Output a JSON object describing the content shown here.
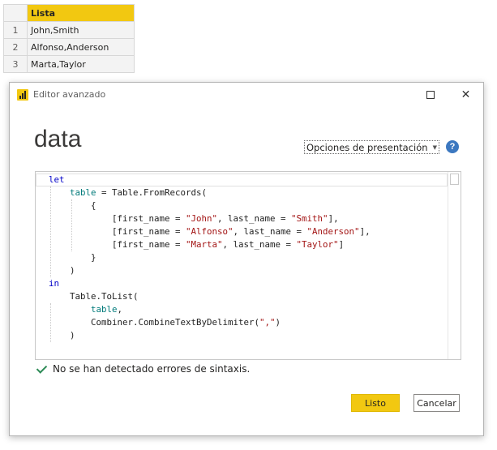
{
  "preview_table": {
    "column_header": "Lista",
    "rows": [
      {
        "num": "1",
        "value": "John,Smith"
      },
      {
        "num": "2",
        "value": "Alfonso,Anderson"
      },
      {
        "num": "3",
        "value": "Marta,Taylor"
      }
    ]
  },
  "dialog": {
    "title": "Editor avanzado",
    "query_name": "data",
    "display_options_label": "Opciones de presentación",
    "help_label": "?",
    "code_lines": [
      [
        {
          "t": "kw",
          "s": "let"
        }
      ],
      [
        {
          "t": "plain",
          "s": "    "
        },
        {
          "t": "id",
          "s": "table"
        },
        {
          "t": "plain",
          "s": " = Table.FromRecords("
        }
      ],
      [
        {
          "t": "plain",
          "s": "        {"
        }
      ],
      [
        {
          "t": "plain",
          "s": "            [first_name = "
        },
        {
          "t": "str",
          "s": "\"John\""
        },
        {
          "t": "plain",
          "s": ", last_name = "
        },
        {
          "t": "str",
          "s": "\"Smith\""
        },
        {
          "t": "plain",
          "s": "],"
        }
      ],
      [
        {
          "t": "plain",
          "s": "            [first_name = "
        },
        {
          "t": "str",
          "s": "\"Alfonso\""
        },
        {
          "t": "plain",
          "s": ", last_name = "
        },
        {
          "t": "str",
          "s": "\"Anderson\""
        },
        {
          "t": "plain",
          "s": "],"
        }
      ],
      [
        {
          "t": "plain",
          "s": "            [first_name = "
        },
        {
          "t": "str",
          "s": "\"Marta\""
        },
        {
          "t": "plain",
          "s": ", last_name = "
        },
        {
          "t": "str",
          "s": "\"Taylor\""
        },
        {
          "t": "plain",
          "s": "]"
        }
      ],
      [
        {
          "t": "plain",
          "s": "        }"
        }
      ],
      [
        {
          "t": "plain",
          "s": "    )"
        }
      ],
      [
        {
          "t": "kw",
          "s": "in"
        }
      ],
      [
        {
          "t": "plain",
          "s": "    Table.ToList("
        }
      ],
      [
        {
          "t": "plain",
          "s": "        "
        },
        {
          "t": "id",
          "s": "table"
        },
        {
          "t": "plain",
          "s": ","
        }
      ],
      [
        {
          "t": "plain",
          "s": "        Combiner.CombineTextByDelimiter("
        },
        {
          "t": "str",
          "s": "\",\""
        },
        {
          "t": "plain",
          "s": ")"
        }
      ],
      [
        {
          "t": "plain",
          "s": "    )"
        }
      ]
    ],
    "status_text": "No se han detectado errores de sintaxis.",
    "ok_label": "Listo",
    "cancel_label": "Cancelar"
  },
  "colors": {
    "accent": "#f2c811",
    "keyword": "#0000c8",
    "identifier": "#007a7a",
    "string": "#a31515",
    "success": "#2e8b57",
    "help": "#3c78c0"
  },
  "icons": [
    "power-bi-icon",
    "minimize-icon",
    "maximize-icon",
    "close-icon",
    "help-icon",
    "check-icon",
    "chevron-down-icon"
  ]
}
